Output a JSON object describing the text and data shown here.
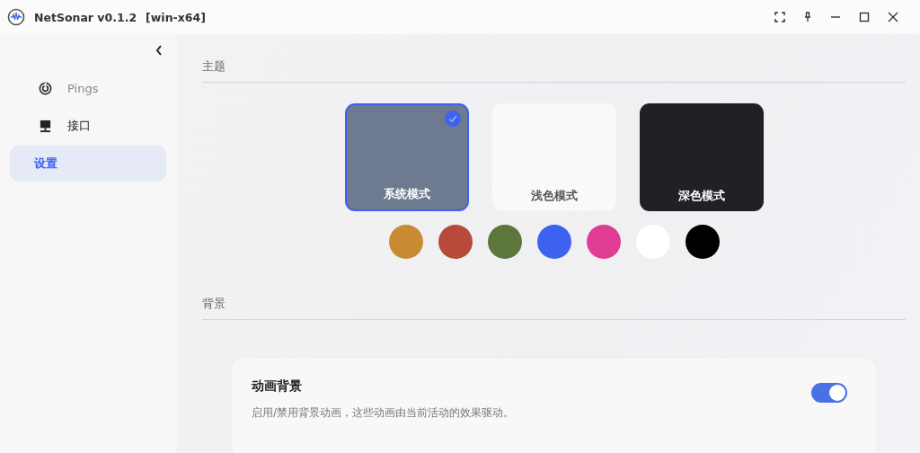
{
  "window": {
    "title": "NetSonar v0.1.2",
    "platform": "[win-x64]"
  },
  "sidebar": {
    "items": [
      {
        "label": "Pings",
        "kind": "pings",
        "selected": false
      },
      {
        "label": "接口",
        "kind": "interface",
        "selected": false
      },
      {
        "label": "设置",
        "kind": "none",
        "selected": true
      }
    ]
  },
  "theme_section": {
    "heading": "主题",
    "modes": [
      {
        "label": "系统模式",
        "kind": "system",
        "selected": true
      },
      {
        "label": "浅色模式",
        "kind": "light",
        "selected": false
      },
      {
        "label": "深色模式",
        "kind": "dark",
        "selected": false
      }
    ],
    "accent_colors": [
      {
        "color": "#c98a34"
      },
      {
        "color": "#b84a3a"
      },
      {
        "color": "#5d763c"
      },
      {
        "color": "#3c62ef"
      },
      {
        "color": "#e03c93"
      },
      {
        "color": "#ffffff"
      },
      {
        "color": "#000000"
      }
    ]
  },
  "background_section": {
    "heading": "背景",
    "setting": {
      "title": "动画背景",
      "description": "启用/禁用背景动画，这些动画由当前活动的效果驱动。",
      "on": true
    }
  }
}
